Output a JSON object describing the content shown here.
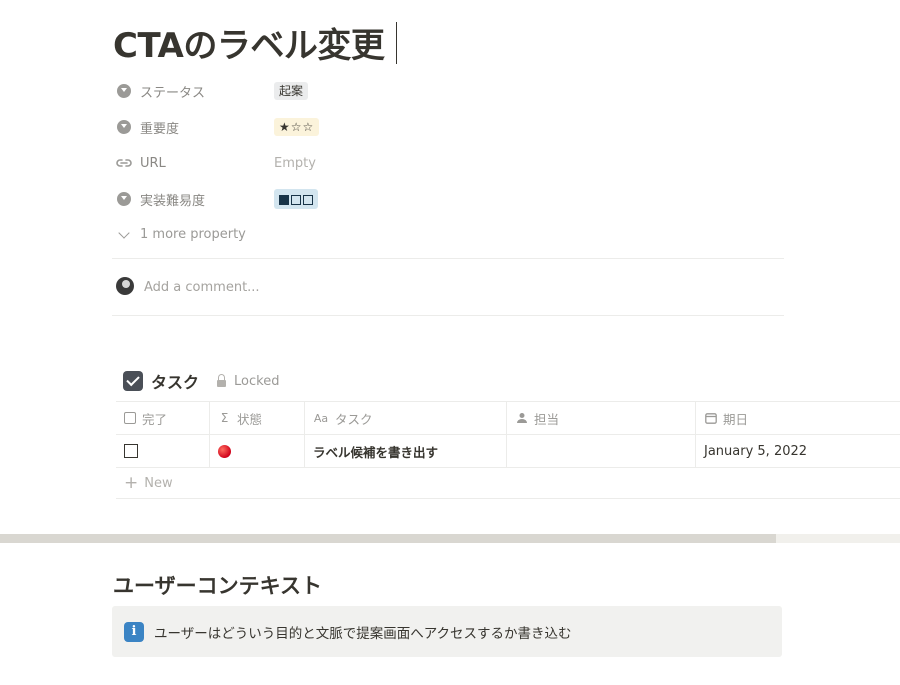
{
  "page": {
    "title": "CTAのラベル変更"
  },
  "properties": [
    {
      "icon": "select-icon",
      "name": "ステータス",
      "value": "起案"
    },
    {
      "icon": "select-icon",
      "name": "重要度",
      "value": "★☆☆"
    },
    {
      "icon": "link-icon",
      "name": "URL",
      "value": "Empty"
    },
    {
      "icon": "select-icon",
      "name": "実装難易度",
      "value": "■□□"
    }
  ],
  "more_properties": "1 more property",
  "comment": {
    "placeholder": "Add a comment..."
  },
  "database": {
    "title": "タスク",
    "locked_label": "Locked",
    "columns": [
      {
        "icon": "checkbox-icon",
        "label": "完了"
      },
      {
        "icon": "formula-icon",
        "label": "状態"
      },
      {
        "icon": "text-icon",
        "label": "タスク"
      },
      {
        "icon": "person-icon",
        "label": "担当"
      },
      {
        "icon": "calendar-icon",
        "label": "期日"
      }
    ],
    "rows": [
      {
        "done": false,
        "status": "red-circle",
        "task": "ラベル候補を書き出す",
        "assignee": "",
        "due": "January 5, 2022"
      }
    ],
    "new_label": "New"
  },
  "section": {
    "heading": "ユーザーコンテキスト",
    "callout_icon": "info-icon",
    "callout_text": "ユーザーはどういう目的と文脈で提案画面へアクセスするか書き込む"
  },
  "colors": {
    "text": "#37352f",
    "muted": "#9b9a97",
    "tag_yellow": "#fbf3db",
    "tag_blue": "#d3e5ef",
    "info": "#3b84c4"
  }
}
